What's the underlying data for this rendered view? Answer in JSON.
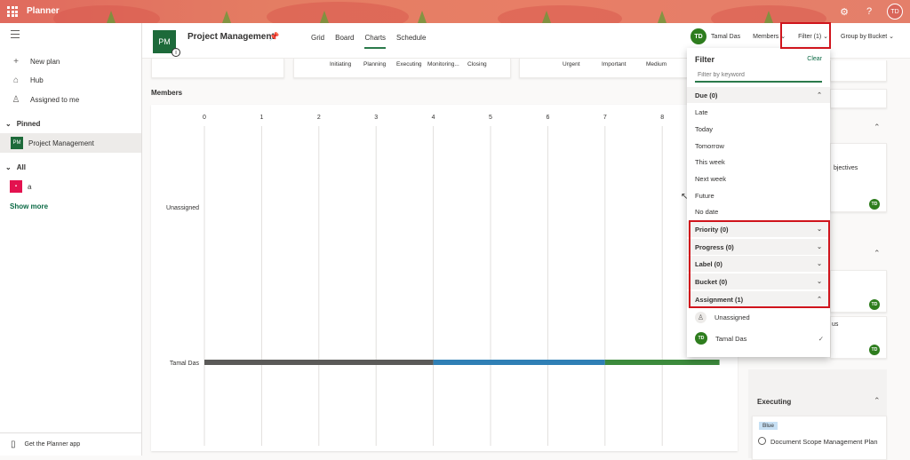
{
  "app": {
    "name": "Planner",
    "user_initials": "TD"
  },
  "topbar": {
    "settings_icon": "gear-icon",
    "help_label": "?"
  },
  "sidebar": {
    "items": [
      {
        "label": "New plan",
        "icon": "plus-icon"
      },
      {
        "label": "Hub",
        "icon": "home-icon"
      },
      {
        "label": "Assigned to me",
        "icon": "person-icon"
      }
    ],
    "pinned_label": "Pinned",
    "pinned_plan": {
      "badge": "PM",
      "label": "Project Management"
    },
    "all_label": "All",
    "all_plan": {
      "badge": "a",
      "label": "a"
    },
    "show_more": "Show more",
    "get_app": "Get the Planner app"
  },
  "header": {
    "logo": "PM",
    "title": "Project Management",
    "tabs": [
      "Grid",
      "Board",
      "Charts",
      "Schedule"
    ],
    "active_tab": "Charts",
    "user_initials": "TD",
    "user_name": "Tamal Das",
    "members": "Members",
    "filter": "Filter (1)",
    "group_by": "Group by Bucket"
  },
  "top_cards": {
    "buckets": [
      "Initiating",
      "Planning",
      "Executing",
      "Monitoring...",
      "Closing"
    ],
    "priorities": [
      "Urgent",
      "Important",
      "Medium"
    ]
  },
  "members_chart": {
    "title": "Members",
    "x_ticks": [
      "0",
      "1",
      "2",
      "3",
      "4",
      "5",
      "6",
      "7",
      "8"
    ],
    "rows": [
      "Unassigned",
      "Tamal Das"
    ]
  },
  "chart_data": {
    "type": "bar",
    "title": "Members",
    "categories": [
      "Unassigned",
      "Tamal Das"
    ],
    "series": [
      {
        "color": "#5b5a58",
        "values": [
          0,
          4
        ]
      },
      {
        "color": "#2f7fb5",
        "values": [
          0,
          3
        ]
      },
      {
        "color": "#3c8a3c",
        "values": [
          0,
          2
        ]
      }
    ],
    "xlim": [
      0,
      9
    ],
    "orientation": "horizontal",
    "stacked": true
  },
  "filter": {
    "title": "Filter",
    "clear": "Clear",
    "placeholder": "Filter by keyword",
    "due": {
      "label": "Due (0)",
      "options": [
        "Late",
        "Today",
        "Tomorrow",
        "This week",
        "Next week",
        "Future",
        "No date"
      ]
    },
    "sections": [
      "Priority (0)",
      "Progress (0)",
      "Label (0)",
      "Bucket (0)"
    ],
    "assignment": {
      "label": "Assignment (1)",
      "options": [
        {
          "label": "Unassigned",
          "icon": "person-icon"
        },
        {
          "label": "Tamal Das",
          "initials": "TD",
          "checked": true
        }
      ]
    }
  },
  "right_column": {
    "objectives_fragment": "bjectives",
    "us_fragment": "us",
    "task_initials": "TD",
    "executing_title": "Executing",
    "label_tag": "Blue",
    "task": "Document Scope Management Plan"
  },
  "colors": {
    "accent": "#2b7a4b",
    "highlight": "#d0141c",
    "label_blue": "#c7e0f4"
  }
}
